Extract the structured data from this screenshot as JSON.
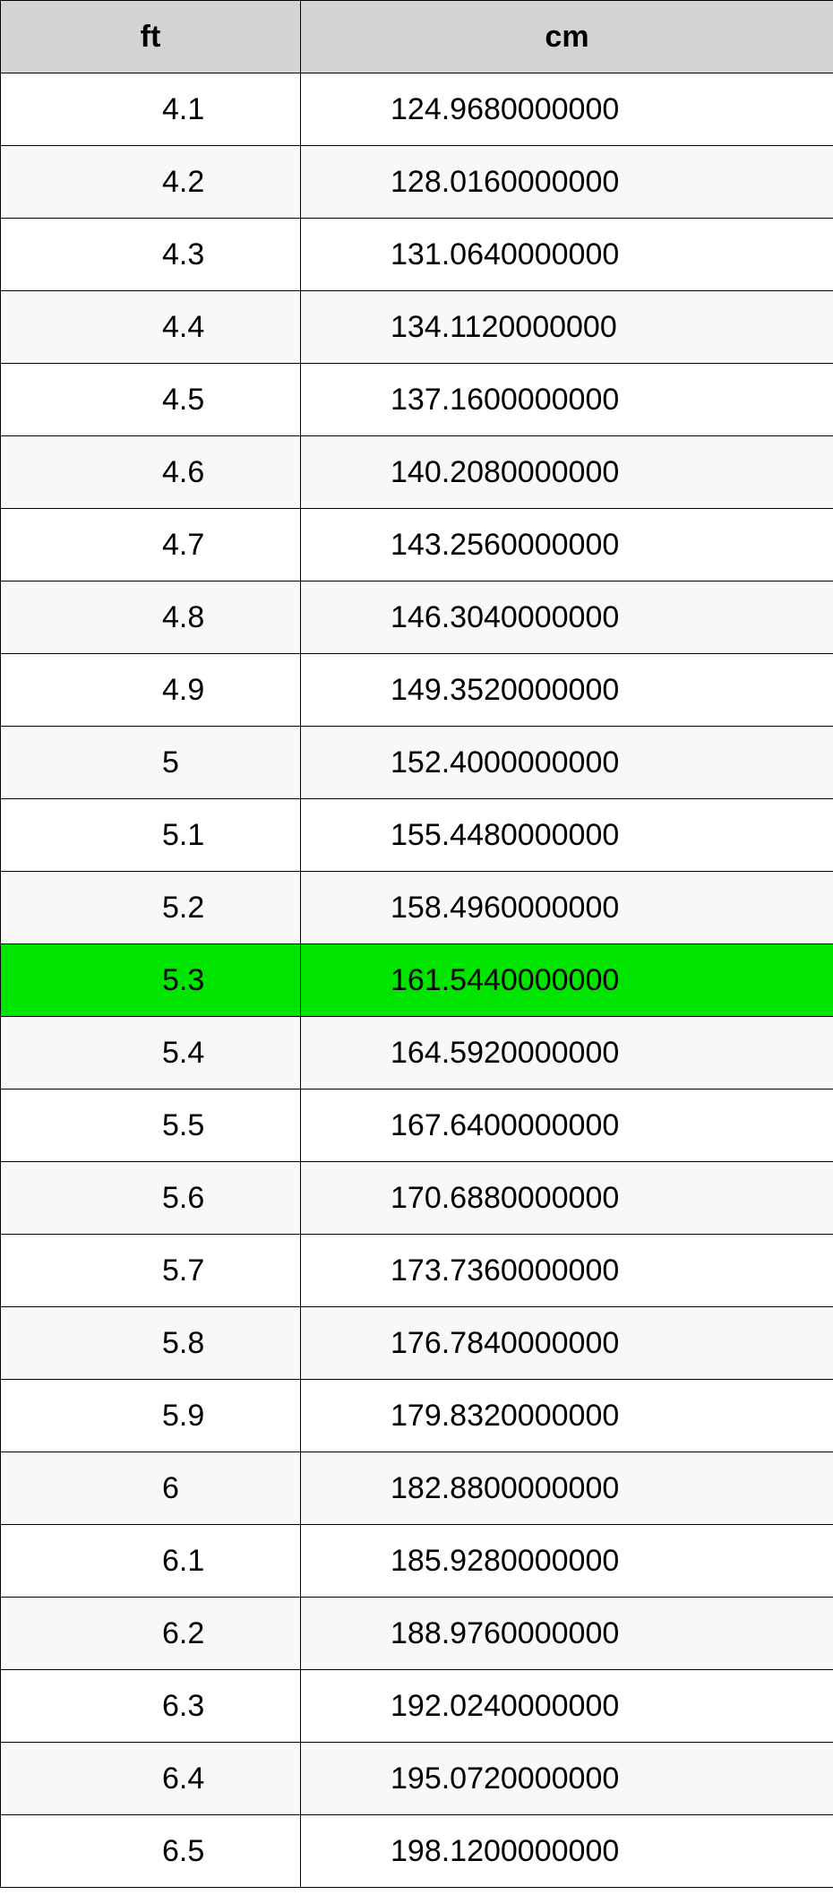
{
  "table": {
    "headers": {
      "ft": "ft",
      "cm": "cm"
    },
    "highlight_index": 12,
    "rows": [
      {
        "ft": "4.1",
        "cm": "124.9680000000"
      },
      {
        "ft": "4.2",
        "cm": "128.0160000000"
      },
      {
        "ft": "4.3",
        "cm": "131.0640000000"
      },
      {
        "ft": "4.4",
        "cm": "134.1120000000"
      },
      {
        "ft": "4.5",
        "cm": "137.1600000000"
      },
      {
        "ft": "4.6",
        "cm": "140.2080000000"
      },
      {
        "ft": "4.7",
        "cm": "143.2560000000"
      },
      {
        "ft": "4.8",
        "cm": "146.3040000000"
      },
      {
        "ft": "4.9",
        "cm": "149.3520000000"
      },
      {
        "ft": "5",
        "cm": "152.4000000000"
      },
      {
        "ft": "5.1",
        "cm": "155.4480000000"
      },
      {
        "ft": "5.2",
        "cm": "158.4960000000"
      },
      {
        "ft": "5.3",
        "cm": "161.5440000000"
      },
      {
        "ft": "5.4",
        "cm": "164.5920000000"
      },
      {
        "ft": "5.5",
        "cm": "167.6400000000"
      },
      {
        "ft": "5.6",
        "cm": "170.6880000000"
      },
      {
        "ft": "5.7",
        "cm": "173.7360000000"
      },
      {
        "ft": "5.8",
        "cm": "176.7840000000"
      },
      {
        "ft": "5.9",
        "cm": "179.8320000000"
      },
      {
        "ft": "6",
        "cm": "182.8800000000"
      },
      {
        "ft": "6.1",
        "cm": "185.9280000000"
      },
      {
        "ft": "6.2",
        "cm": "188.9760000000"
      },
      {
        "ft": "6.3",
        "cm": "192.0240000000"
      },
      {
        "ft": "6.4",
        "cm": "195.0720000000"
      },
      {
        "ft": "6.5",
        "cm": "198.1200000000"
      }
    ]
  }
}
